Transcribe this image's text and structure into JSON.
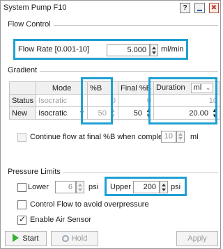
{
  "window": {
    "title": "System Pump F10",
    "help_glyph": "?",
    "close_glyph": "✖"
  },
  "flow_control": {
    "group_label": "Flow Control",
    "rate_label": "Flow Rate [0.001-10]",
    "rate_value": "5.000",
    "rate_unit": "ml/min"
  },
  "gradient": {
    "group_label": "Gradient",
    "headers": {
      "mode": "Mode",
      "pct_b": "%B",
      "final_pct_b": "Final %B",
      "duration": "Duration",
      "duration_unit": "ml"
    },
    "status_row": {
      "label": "Status",
      "mode": "Isocratic",
      "pct_b": "0",
      "final_pct_b": "0",
      "duration": "10"
    },
    "new_row": {
      "label": "New",
      "mode": "Isocratic",
      "pct_b": "50",
      "final_pct_b": "50",
      "duration": "20.00"
    },
    "continue_label": "Continue flow at final %B when complete",
    "continue_value": "10",
    "continue_unit": "ml"
  },
  "pressure_limits": {
    "group_label": "Pressure Limits",
    "lower_label": "Lower",
    "lower_value": "6",
    "lower_unit": "psi",
    "upper_label": "Upper",
    "upper_value": "200",
    "upper_unit": "psi",
    "control_flow_label": "Control Flow to avoid overpressure",
    "control_flow_checked": false,
    "air_sensor_label": "Enable Air Sensor",
    "air_sensor_checked": true
  },
  "buttons": {
    "start": "Start",
    "hold": "Hold",
    "apply": "Apply"
  },
  "colors": {
    "highlight": "#1ea0d2",
    "start_icon": "#34b233"
  }
}
